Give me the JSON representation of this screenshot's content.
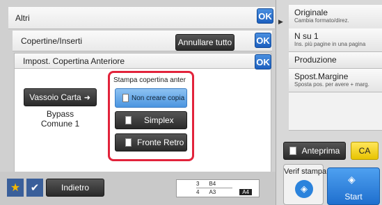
{
  "header": {
    "title": "Altri",
    "ok": "OK"
  },
  "covers": {
    "title": "Copertine/Inserti",
    "cancel_all": "Annullare tutto",
    "ok": "OK"
  },
  "front_cover": {
    "title": "Impost. Copertina Anteriore",
    "ok": "OK"
  },
  "tray": {
    "button": "Vassoio Carta",
    "source_line1": "Bypass",
    "source_line2": "Comune 1"
  },
  "print_cover": {
    "title": "Stampa copertina anter",
    "options": [
      "Non creare copia",
      "Simplex",
      "Fronte Retro"
    ],
    "selected": 0
  },
  "right_panel": {
    "items": [
      {
        "title": "Originale",
        "sub": "Cambia formato/direz."
      },
      {
        "title": "N su 1",
        "sub": "Ins. più pagine in una pagina"
      },
      {
        "title": "Produzione",
        "sub": ""
      },
      {
        "title": "Spost.Margine",
        "sub": "Sposta pos. per avere + marg."
      }
    ],
    "preview": "Anteprima",
    "ca": "CA",
    "verify": "Verif stampa",
    "start": "Start"
  },
  "bottom": {
    "back": "Indietro",
    "tray_rows": [
      {
        "num": "3",
        "size": "B4"
      },
      {
        "num": "4",
        "size": "A3"
      }
    ],
    "paper": "A4"
  },
  "colors": {
    "ok": "#1c5fbf",
    "selected": "#5aa3e8",
    "highlight": "#e2233b",
    "ca": "#f6d200",
    "start": "#2b83dc"
  }
}
